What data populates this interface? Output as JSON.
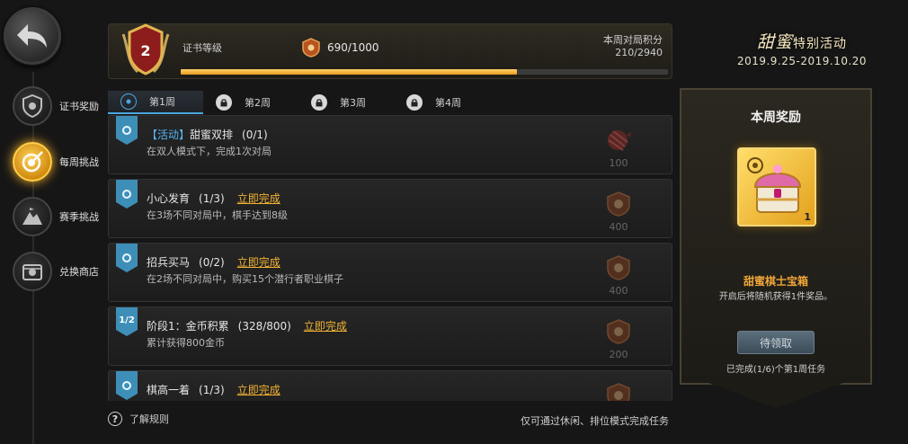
{
  "nav": {
    "items": [
      {
        "label": "证书奖励",
        "icon": "shield-icon"
      },
      {
        "label": "每周挑战",
        "icon": "target-icon",
        "active": true
      },
      {
        "label": "赛季挑战",
        "icon": "mountain-icon"
      },
      {
        "label": "兑换商店",
        "icon": "shop-icon"
      }
    ]
  },
  "header": {
    "rank_level": "2",
    "level_label": "证书等级",
    "exp_text": "690/1000",
    "exp_progress": 0.69,
    "week_score_label": "本周对局积分",
    "week_score_value": "210/2940"
  },
  "event": {
    "title_main": "甜蜜",
    "title_sub": "特别活动",
    "dates": "2019.9.25-2019.10.20"
  },
  "tabs": [
    {
      "label": "第1周",
      "state": "active",
      "icon": "target-icon"
    },
    {
      "label": "第2周",
      "state": "locked",
      "icon": "lock-icon"
    },
    {
      "label": "第3周",
      "state": "locked",
      "icon": "lock-icon"
    },
    {
      "label": "第4周",
      "state": "locked",
      "icon": "lock-icon"
    }
  ],
  "tasks": [
    {
      "flag": "",
      "tag": "【活动】",
      "title": "甜蜜双排",
      "progress": "(0/1)",
      "action": "",
      "desc": "在双人模式下，完成1次对局",
      "reward": "100"
    },
    {
      "flag": "",
      "tag": "",
      "title": "小心发育",
      "progress": "(1/3)",
      "action": "立即完成",
      "desc": "在3场不同对局中，棋手达到8级",
      "reward": "400"
    },
    {
      "flag": "",
      "tag": "",
      "title": "招兵买马",
      "progress": "(0/2)",
      "action": "立即完成",
      "desc": "在2场不同对局中，购买15个潜行者职业棋子",
      "reward": "400"
    },
    {
      "flag": "1/2",
      "tag": "",
      "title": "阶段1：金币积累",
      "progress": "(328/800)",
      "action": "立即完成",
      "desc": "累计获得800金币",
      "reward": "200"
    },
    {
      "flag": "",
      "tag": "",
      "title": "棋高一着",
      "progress": "(1/3)",
      "action": "立即完成",
      "desc": "",
      "reward": ""
    }
  ],
  "reward_panel": {
    "title": "本周奖励",
    "item_count": "1",
    "item_name": "甜蜜棋士宝箱",
    "item_desc": "开启后将随机获得1件奖品。",
    "button_label": "待领取",
    "status": "已完成(1/6)个第1周任务"
  },
  "footer": {
    "help_label": "了解规则",
    "note": "仅可通过休闲、排位模式完成任务"
  },
  "colors": {
    "accent_gold": "#f2b233",
    "accent_blue": "#4aa8e0",
    "event_tag": "#56b5f0"
  }
}
